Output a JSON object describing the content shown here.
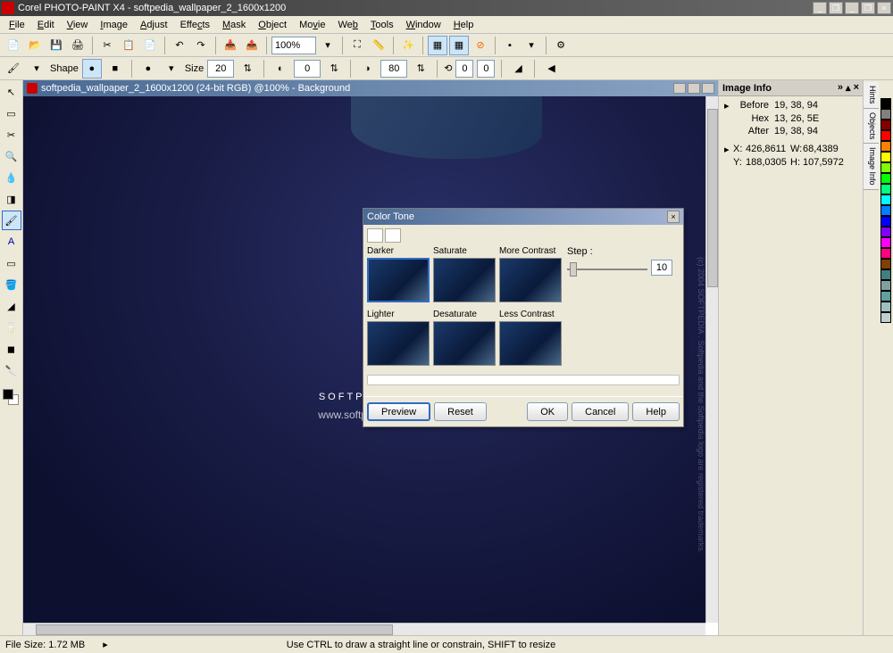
{
  "app": {
    "title": "Corel PHOTO-PAINT X4 - softpedia_wallpaper_2_1600x1200"
  },
  "menu": [
    "File",
    "Edit",
    "View",
    "Image",
    "Adjust",
    "Effects",
    "Mask",
    "Object",
    "Movie",
    "Web",
    "Tools",
    "Window",
    "Help"
  ],
  "toolbar": {
    "zoom": "100%"
  },
  "propbar": {
    "shape_label": "Shape",
    "size_label": "Size",
    "size": "20",
    "val1": "0",
    "val2": "80",
    "rot1": "0",
    "rot2": "0"
  },
  "doc": {
    "title": "softpedia_wallpaper_2_1600x1200 (24-bit RGB) @100% - Background"
  },
  "canvas": {
    "brand": "SOFTPEDIA",
    "tm": "™",
    "url": "www.softpedia.com",
    "copyright": "(c) 2004 SOFTPEDIA . Softpedia and the Softpedia logo are registered trademarks."
  },
  "info_panel": {
    "title": "Image Info",
    "before_label": "Before",
    "before": "19, 38, 94",
    "hex_label": "Hex",
    "hex": "13, 26, 5E",
    "after_label": "After",
    "after": "19, 38, 94",
    "x_label": "X:",
    "x": "426,8611",
    "w_label": "W:",
    "w": "68,4389",
    "y_label": "Y:",
    "y": "188,0305",
    "h_label": "H:",
    "h": "107,5972"
  },
  "right_tabs": [
    "Hints",
    "Objects",
    "Image Info"
  ],
  "dialog": {
    "title": "Color Tone",
    "thumbs_row1": [
      "Darker",
      "Saturate",
      "More Contrast"
    ],
    "thumbs_row2": [
      "Lighter",
      "Desaturate",
      "Less Contrast"
    ],
    "step_label": "Step :",
    "step_value": "10",
    "preview": "Preview",
    "reset": "Reset",
    "ok": "OK",
    "cancel": "Cancel",
    "help": "Help"
  },
  "status": {
    "filesize": "File Size: 1.72 MB",
    "hint": "Use CTRL to draw a straight line or constrain, SHIFT to resize"
  },
  "palette": [
    "#000000",
    "#808080",
    "#800000",
    "#ff0000",
    "#ff8000",
    "#ffff00",
    "#80ff00",
    "#00ff00",
    "#00ff80",
    "#00ffff",
    "#0080ff",
    "#0000ff",
    "#8000ff",
    "#ff00ff",
    "#ff0080",
    "#804000",
    "#408080",
    "#80a0a0",
    "#60a0a0",
    "#a0c0c0",
    "#c0d0d0"
  ]
}
